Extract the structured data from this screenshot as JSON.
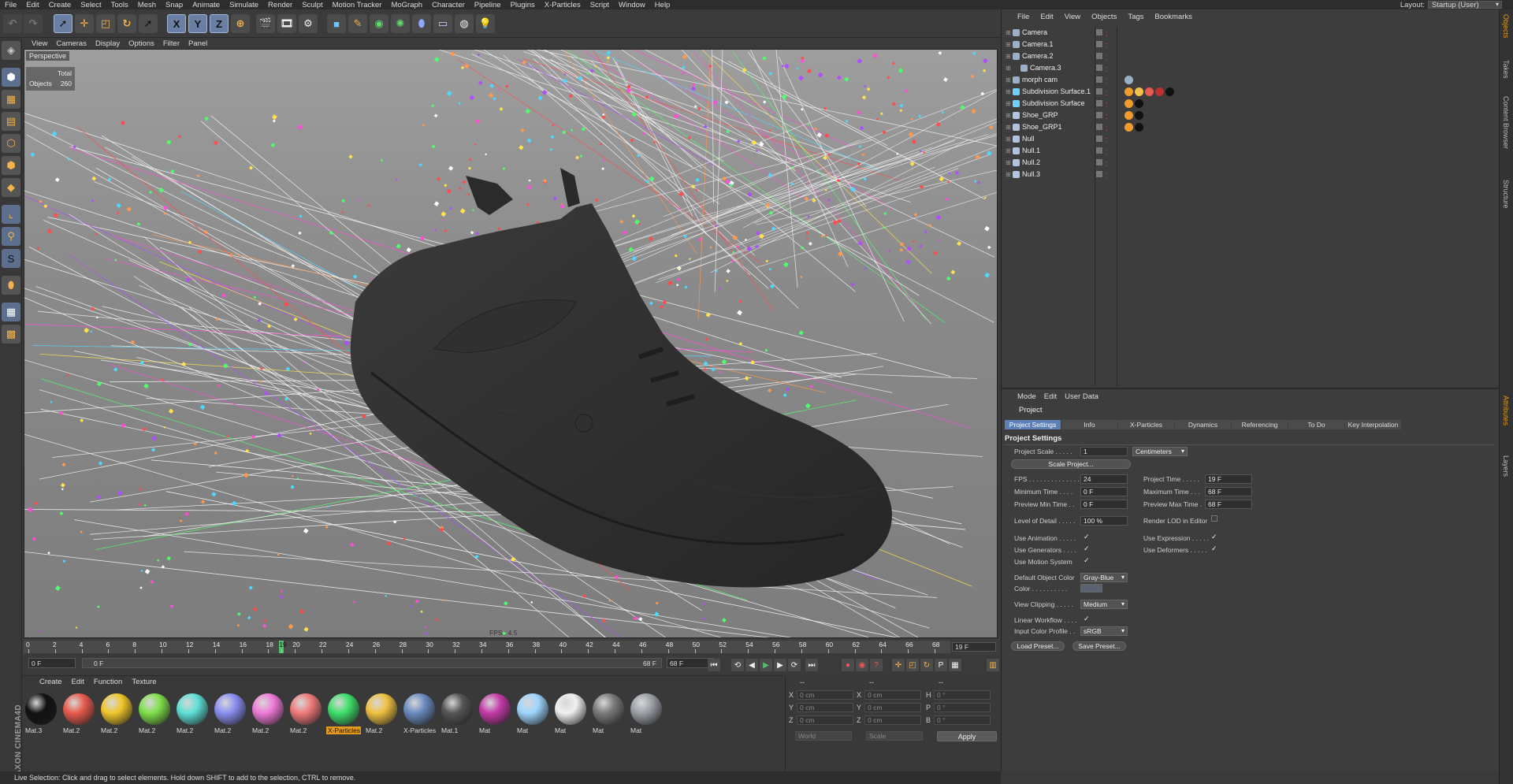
{
  "menu": [
    "File",
    "Edit",
    "Create",
    "Select",
    "Tools",
    "Mesh",
    "Snap",
    "Animate",
    "Simulate",
    "Render",
    "Sculpt",
    "Motion Tracker",
    "MoGraph",
    "Character",
    "Pipeline",
    "Plugins",
    "X-Particles",
    "Script",
    "Window",
    "Help"
  ],
  "layout": {
    "label": "Layout:",
    "value": "Startup (User)"
  },
  "toolbar": {
    "x": "X",
    "y": "Y",
    "z": "Z"
  },
  "viewport": {
    "menu": [
      "View",
      "Cameras",
      "Display",
      "Options",
      "Filter",
      "Panel"
    ],
    "label": "Perspective",
    "stats_header": "Total",
    "stats_label": "Objects",
    "stats_value": "260",
    "fps": "FPS : 4.5"
  },
  "timeline": {
    "ticks": [
      "0",
      "2",
      "4",
      "6",
      "8",
      "10",
      "12",
      "14",
      "16",
      "18",
      "19",
      "20",
      "22",
      "24",
      "26",
      "28",
      "30",
      "32",
      "34",
      "36",
      "38",
      "40",
      "42",
      "44",
      "46",
      "48",
      "50",
      "52",
      "54",
      "56",
      "58",
      "60",
      "62",
      "64",
      "66",
      "68"
    ],
    "current": "19 F"
  },
  "transport": {
    "start": "0 F",
    "range_start": "0 F",
    "range_end": "68 F",
    "end": "68 F"
  },
  "materials": {
    "menu": [
      "Create",
      "Edit",
      "Function",
      "Texture"
    ],
    "items": [
      {
        "name": "Mat.3",
        "color": "#111111"
      },
      {
        "name": "Mat.2",
        "color": "#e85a4c"
      },
      {
        "name": "Mat.2",
        "color": "#f2c62a"
      },
      {
        "name": "Mat.2",
        "color": "#7fe04a"
      },
      {
        "name": "Mat.2",
        "color": "#5ee0d6"
      },
      {
        "name": "Mat.2",
        "color": "#8a8ef0"
      },
      {
        "name": "Mat.2",
        "color": "#f07ad8"
      },
      {
        "name": "Mat.2",
        "color": "#f07a7a"
      },
      {
        "name": "X-Particles",
        "color": "#3ee06a"
      },
      {
        "name": "Mat.2",
        "color": "#f0c040"
      },
      {
        "name": "X-Particles",
        "color": "#6a8ac0"
      },
      {
        "name": "Mat.1",
        "color": "#555555"
      },
      {
        "name": "Mat",
        "color": "#c43aa8"
      },
      {
        "name": "Mat",
        "color": "#9ed6ff"
      },
      {
        "name": "Mat",
        "color": "#f0f0f0"
      },
      {
        "name": "Mat",
        "color": "#7a7a7a"
      },
      {
        "name": "Mat",
        "color": "#9aa0a6"
      }
    ]
  },
  "coords": {
    "header": "--",
    "rows": [
      {
        "a": "X",
        "av": "0 cm",
        "b": "X",
        "bv": "0 cm",
        "c": "H",
        "cv": "0 °"
      },
      {
        "a": "Y",
        "av": "0 cm",
        "b": "Y",
        "bv": "0 cm",
        "c": "P",
        "cv": "0 °"
      },
      {
        "a": "Z",
        "av": "0 cm",
        "b": "Z",
        "bv": "0 cm",
        "c": "B",
        "cv": "0 °"
      }
    ],
    "world": "World",
    "scale": "Scale",
    "apply": "Apply"
  },
  "status": "Live Selection: Click and drag to select elements. Hold down SHIFT to add to the selection, CTRL to remove.",
  "objects": {
    "menu": [
      "File",
      "Edit",
      "View",
      "Objects",
      "Tags",
      "Bookmarks"
    ],
    "items": [
      {
        "name": "Camera",
        "indent": 0,
        "icon": "#9ab0c8"
      },
      {
        "name": "Camera.1",
        "indent": 0,
        "icon": "#9ab0c8"
      },
      {
        "name": "Camera.2",
        "indent": 0,
        "icon": "#9ab0c8"
      },
      {
        "name": "Camera.3",
        "indent": 1,
        "icon": "#9ab0c8"
      },
      {
        "name": "morph cam",
        "indent": 0,
        "icon": "#9ab0c8"
      },
      {
        "name": "Subdivision Surface.1",
        "indent": 0,
        "icon": "#6fd0ff"
      },
      {
        "name": "Subdivision Surface",
        "indent": 0,
        "icon": "#6fd0ff"
      },
      {
        "name": "Shoe_GRP",
        "indent": 0,
        "icon": "#b0c4e0"
      },
      {
        "name": "Shoe_GRP1",
        "indent": 0,
        "icon": "#b0c4e0"
      },
      {
        "name": "Null",
        "indent": 0,
        "icon": "#b0c4e0"
      },
      {
        "name": "Null.1",
        "indent": 0,
        "icon": "#b0c4e0"
      },
      {
        "name": "Null.2",
        "indent": 0,
        "icon": "#b0c4e0"
      },
      {
        "name": "Null.3",
        "indent": 0,
        "icon": "#b0c4e0"
      }
    ]
  },
  "side_tabs": [
    "Objects",
    "Takes",
    "Content Browser",
    "Structure"
  ],
  "side_tabs2": [
    "Attributes",
    "Layers"
  ],
  "attributes": {
    "menu": [
      "Mode",
      "Edit",
      "User Data"
    ],
    "object": "Project",
    "tabs": [
      "Project Settings",
      "Info",
      "X-Particles",
      "Dynamics",
      "Referencing",
      "To Do",
      "Key Interpolation"
    ],
    "section": "Project Settings",
    "project_scale_label": "Project Scale . . . . .",
    "project_scale": "1",
    "project_scale_unit": "Centimeters",
    "scale_project": "Scale Project...",
    "fps_label": "FPS . . . . . . . . . . . . . .",
    "fps": "24",
    "project_time_label": "Project Time . . . . .",
    "project_time": "19 F",
    "min_time_label": "Minimum Time . . . .",
    "min_time": "0 F",
    "max_time_label": "Maximum Time . . .",
    "max_time": "68 F",
    "prev_min_label": "Preview Min Time . .",
    "prev_min": "0 F",
    "prev_max_label": "Preview Max Time .",
    "prev_max": "68 F",
    "lod_label": "Level of Detail . . . . .",
    "lod": "100 %",
    "render_lod_label": "Render LOD in Editor",
    "use_anim_label": "Use Animation . . . . .",
    "use_expr_label": "Use Expression . . . . .",
    "use_gen_label": "Use Generators . . . .",
    "use_def_label": "Use Deformers . . . . .",
    "use_motion_label": "Use Motion System",
    "check": "✓",
    "default_color_label": "Default Object Color",
    "default_color": "Gray-Blue",
    "color_label": "Color . . . . . . . . . .",
    "view_clip_label": "View Clipping . . . . .",
    "view_clip": "Medium",
    "linear_label": "Linear Workflow . . . .",
    "input_profile_label": "Input Color Profile . .",
    "input_profile": "sRGB",
    "load_preset": "Load Preset...",
    "save_preset": "Save Preset..."
  }
}
